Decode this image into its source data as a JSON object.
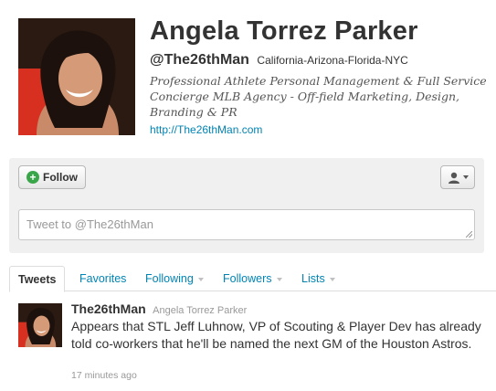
{
  "profile": {
    "name": "Angela Torrez Parker",
    "handle": "@The26thMan",
    "location": "California-Arizona-Florida-NYC",
    "bio": "Professional Athlete Personal Management & Full Service Concierge MLB Agency - Off-field Marketing, Design, Branding & PR",
    "url": "http://The26thMan.com",
    "avatar_icon": "profile-photo"
  },
  "actions": {
    "follow_label": "Follow",
    "follow_icon": "plus-circle-icon",
    "user_menu_icon": "person-icon",
    "tweet_placeholder": "Tweet to @The26thMan"
  },
  "tabs": [
    {
      "label": "Tweets",
      "active": true
    },
    {
      "label": "Favorites"
    },
    {
      "label": "Following"
    },
    {
      "label": "Followers"
    },
    {
      "label": "Lists"
    }
  ],
  "tweet": {
    "screen_name": "The26thMan",
    "full_name": "Angela Torrez Parker",
    "text": "Appears that STL Jeff Luhnow, VP of Scouting & Player Dev has already told co-workers that he'll be named the next GM of the Houston Astros.",
    "time": "17 minutes ago"
  },
  "colors": {
    "link": "#0084b4",
    "follow_icon": "#3aa64a",
    "action_box": "#f0f0f0"
  }
}
